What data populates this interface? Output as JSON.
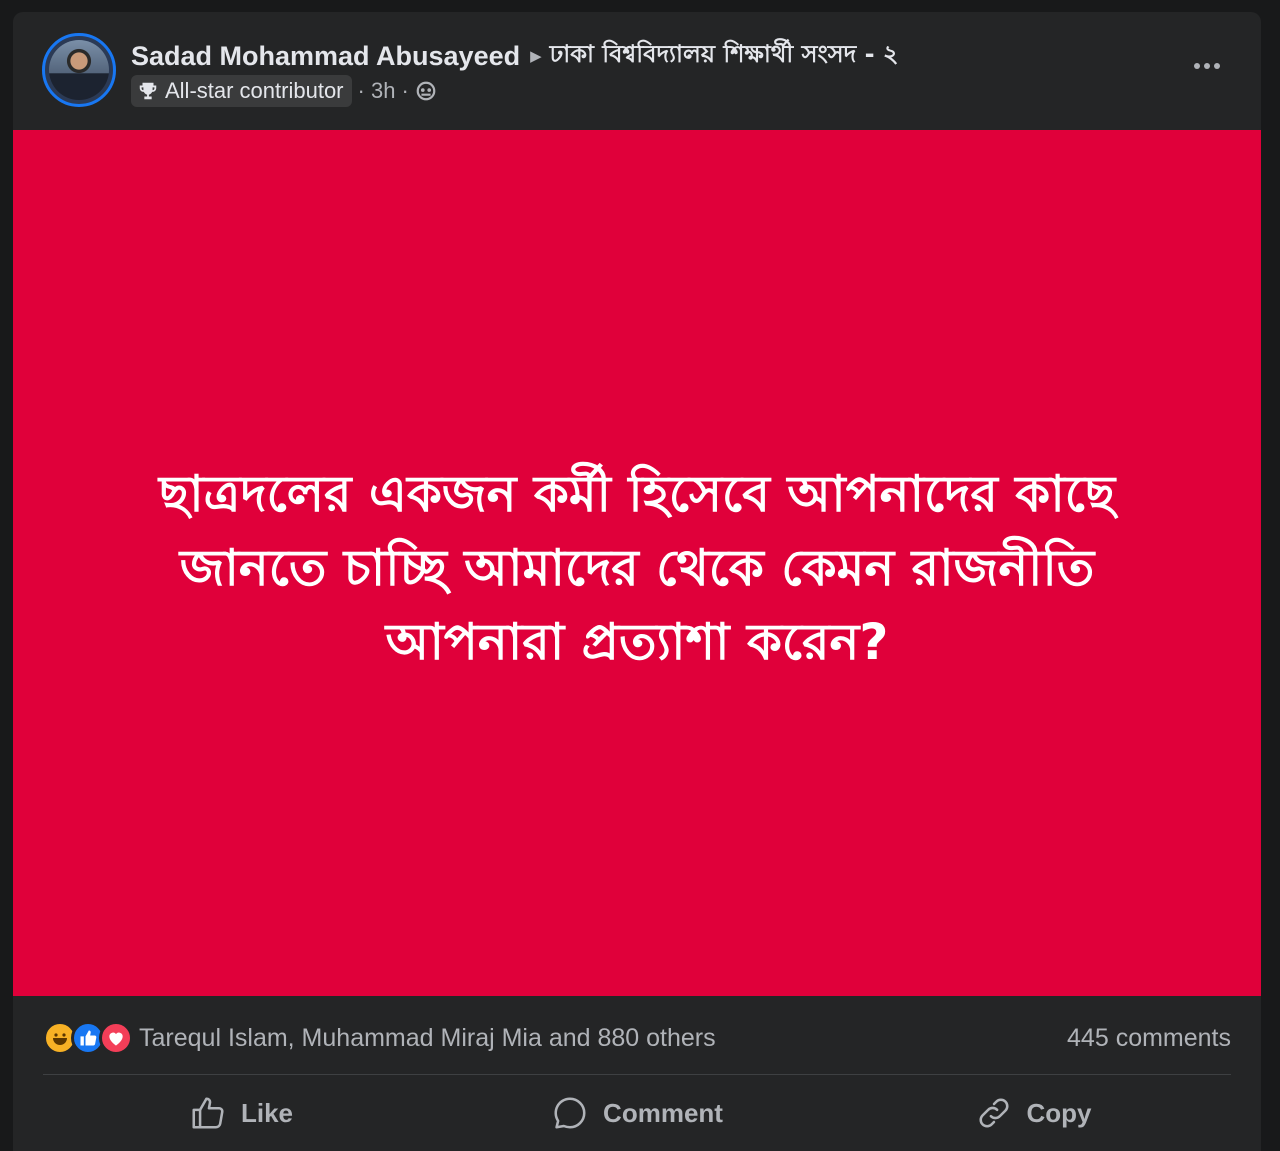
{
  "post": {
    "author": "Sadad Mohammad Abusayeed",
    "group": "ঢাকা বিশ্ববিদ্যালয় শিক্ষার্থী সংসদ - ২",
    "badge": "All-star contributor",
    "time": "· 3h ·",
    "image_text": "ছাত্রদলের একজন কর্মী হিসেবে আপনাদের কাছে জানতে চাচ্ছি আমাদের থেকে কেমন রাজনীতি আপনারা প্রত্যাশা করেন?",
    "image_bg": "#e0003a"
  },
  "reactions": {
    "icons": [
      "haha-icon",
      "like-icon",
      "love-icon"
    ],
    "summary": "Tarequl Islam, Muhammad Miraj Mia and 880 others",
    "comments": "445 comments"
  },
  "actions": {
    "like": "Like",
    "comment": "Comment",
    "copy": "Copy"
  },
  "colors": {
    "accent": "#1877f2",
    "surface": "#242526",
    "text_primary": "#e4e6eb",
    "text_secondary": "#b0b3b8"
  }
}
